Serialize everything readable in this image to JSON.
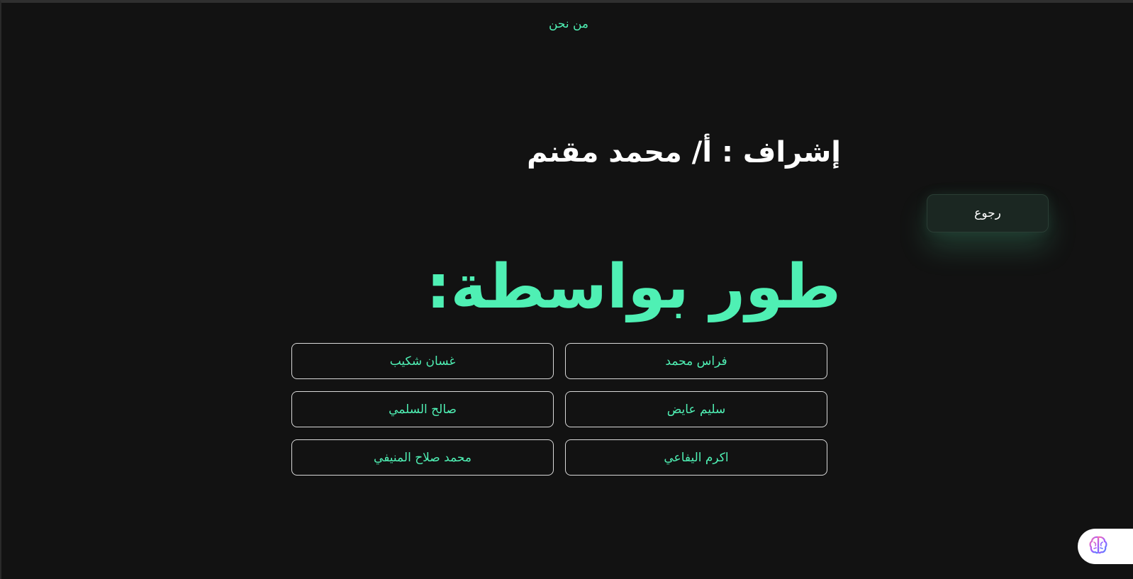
{
  "nav": {
    "about_label": "من نحن"
  },
  "supervisor": {
    "text": "إشراف : أ/ محمد مقنم"
  },
  "back_button": {
    "label": "رجوع"
  },
  "heading": {
    "text": "طور بواسطة:"
  },
  "developers": [
    {
      "name": "فراس محمد"
    },
    {
      "name": "غسان شكيب"
    },
    {
      "name": "سليم عايض"
    },
    {
      "name": "صالح السلمي"
    },
    {
      "name": "اكرم اليفاعي"
    },
    {
      "name": "محمد صلاح المنيفي"
    }
  ],
  "colors": {
    "background": "#121212",
    "accent": "#4ff0b4",
    "text": "#ffffff",
    "card_border": "#d9d9d9"
  },
  "icons": {
    "assistant": "brain-icon"
  }
}
